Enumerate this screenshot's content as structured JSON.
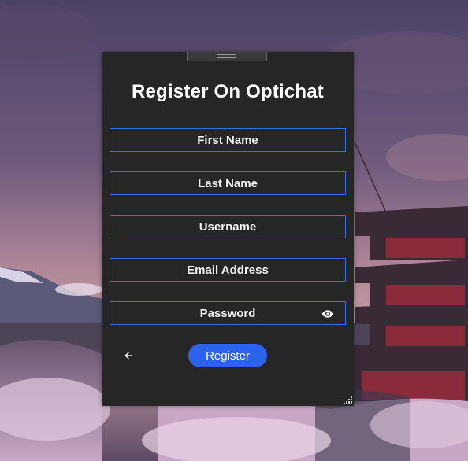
{
  "window": {
    "title": "Register On Optichat"
  },
  "form": {
    "first_name": {
      "value": "",
      "placeholder": "First Name"
    },
    "last_name": {
      "value": "",
      "placeholder": "Last Name"
    },
    "username": {
      "value": "",
      "placeholder": "Username"
    },
    "email": {
      "value": "",
      "placeholder": "Email Address"
    },
    "password": {
      "value": "",
      "placeholder": "Password"
    },
    "register_label": "Register"
  },
  "icons": {
    "password_toggle": "eye-icon",
    "back": "arrow-left-icon",
    "resize": "resize-grip-icon"
  },
  "colors": {
    "window_bg": "#262626",
    "field_border": "#3b6ddf",
    "accent": "#2c62ee",
    "text": "#ffffff"
  }
}
